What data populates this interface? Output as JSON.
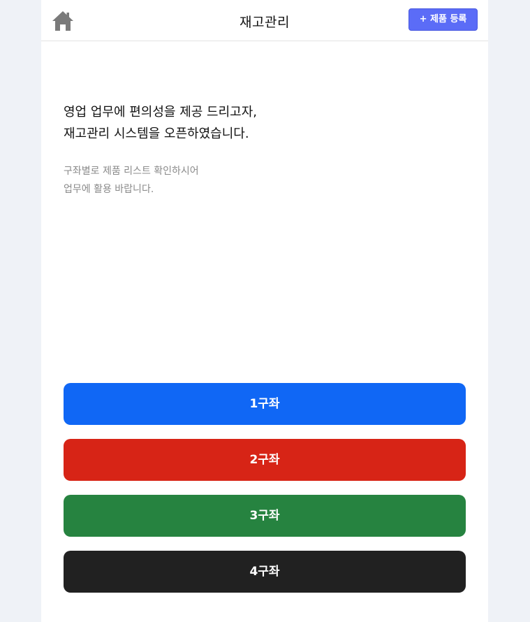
{
  "header": {
    "title": "재고관리",
    "home_icon": "home-icon",
    "register_label": "+ 제품 등록"
  },
  "intro": {
    "headline_line1": "영업 업무에 편의성을 제공 드리고자,",
    "headline_line2": "재고관리 시스템을 오픈하였습니다.",
    "sub_line1": "구좌별로 제품 리스트 확인하시어",
    "sub_line2": "업무에 활용 바랍니다."
  },
  "accounts": [
    {
      "label": "1구좌",
      "color": "#1067f5"
    },
    {
      "label": "2구좌",
      "color": "#d72416"
    },
    {
      "label": "3구좌",
      "color": "#268340"
    },
    {
      "label": "4구좌",
      "color": "#212121"
    }
  ],
  "colors": {
    "background": "#eff2f7",
    "register_button": "#5b6cf7",
    "home_icon": "#7a7a7a"
  }
}
